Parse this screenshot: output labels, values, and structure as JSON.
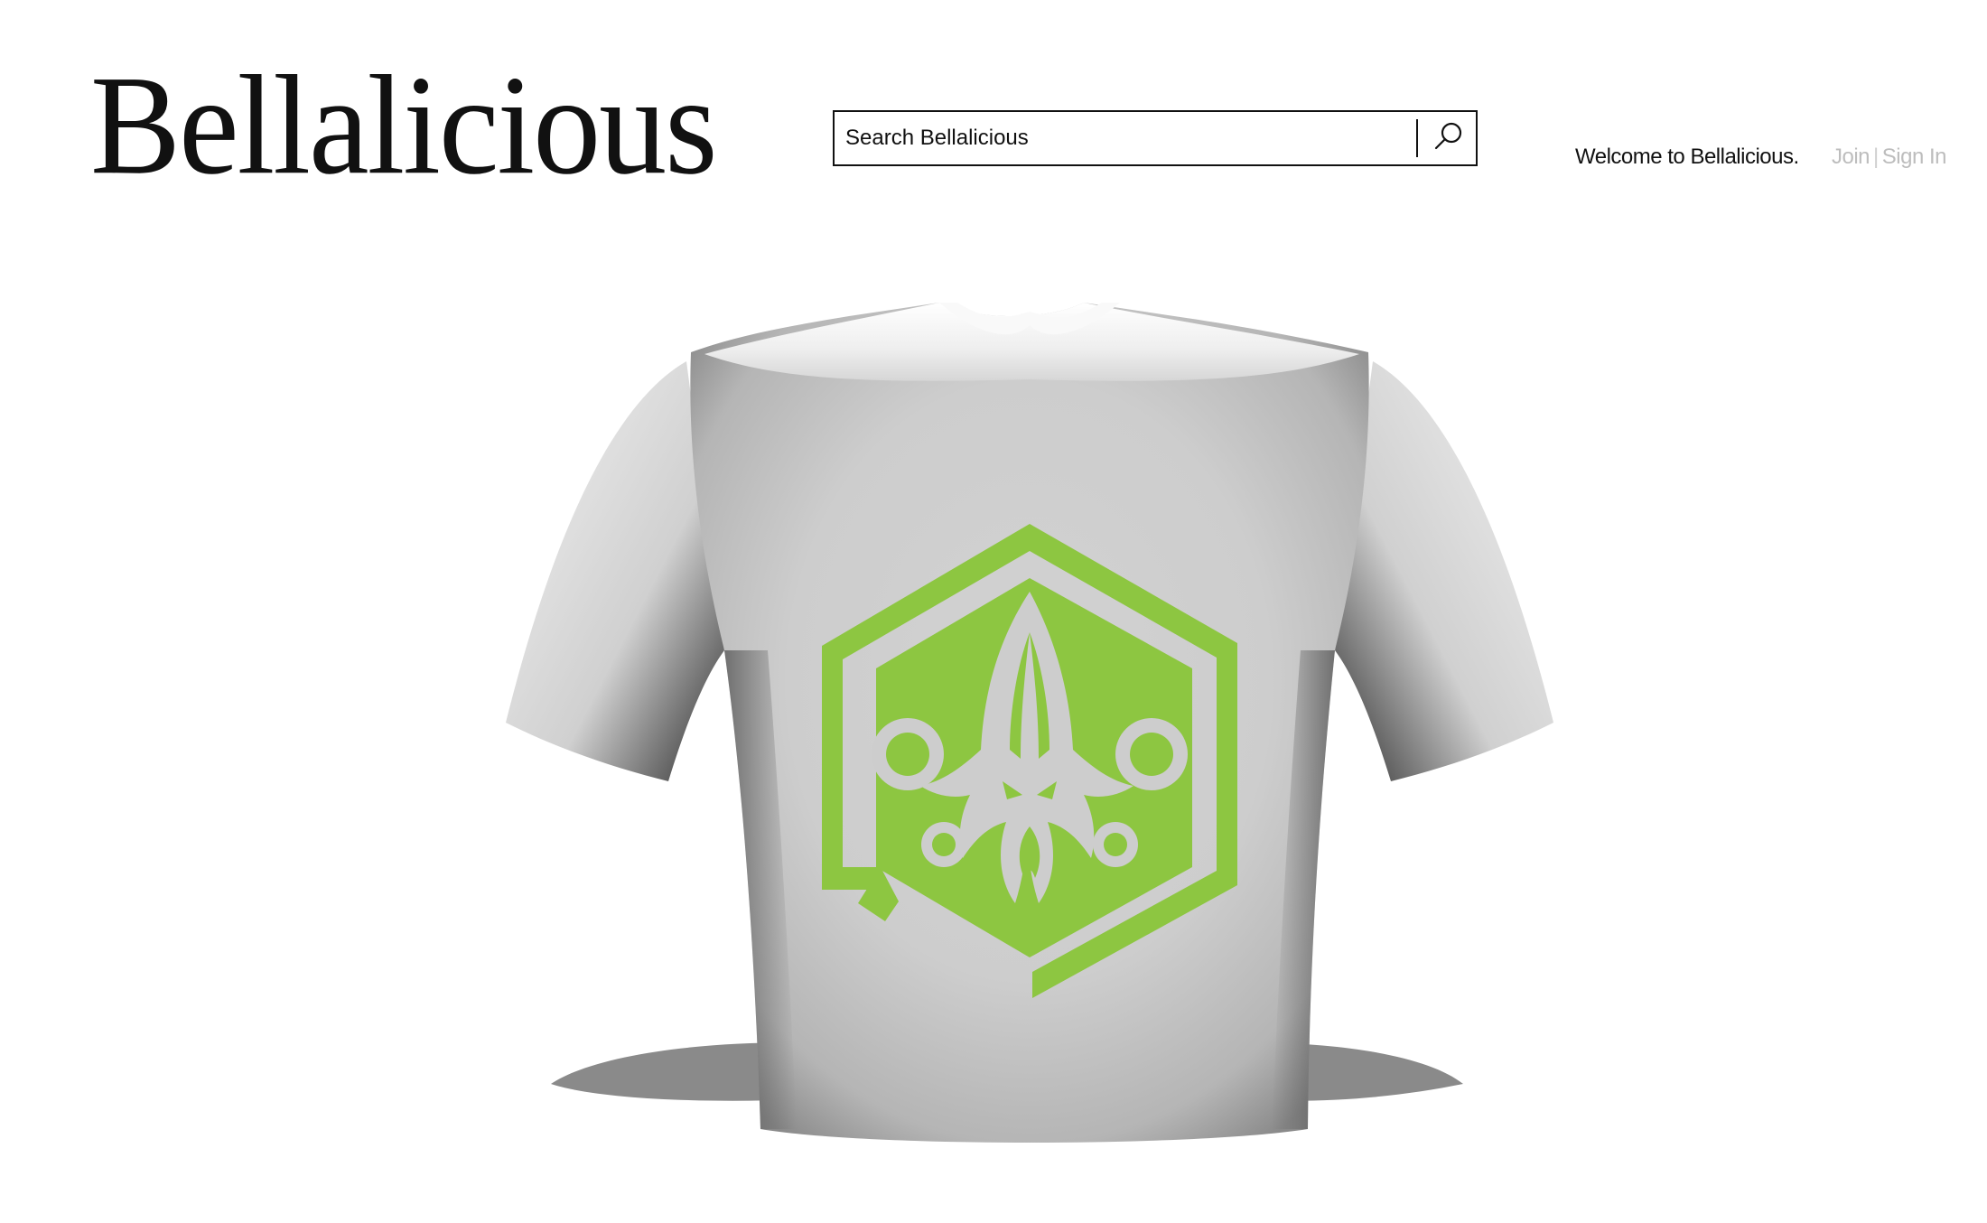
{
  "header": {
    "logo_text": "Bellalicious",
    "welcome_text": "Welcome to Bellalicious.",
    "join_label": "Join",
    "separator": "|",
    "sign_in_label": "Sign In"
  },
  "search": {
    "placeholder": "Search Bellalicious",
    "value": "",
    "button_icon": "search-icon"
  },
  "product": {
    "item": "t-shirt-3d-model",
    "shirt_color": "#e6e6e6",
    "graphic_color": "#8dc641",
    "graphic_icon": "kraken-hexagon-emblem"
  }
}
